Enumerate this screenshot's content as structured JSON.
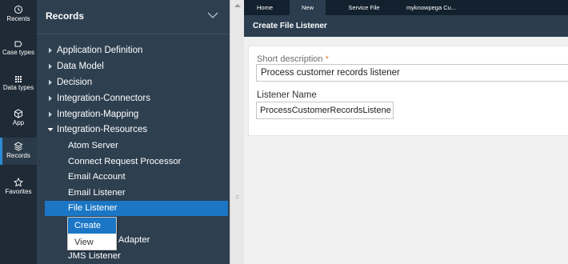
{
  "rail": {
    "items": [
      {
        "label": "Recents",
        "icon": "history-icon"
      },
      {
        "label": "Case types",
        "icon": "case-types-icon"
      },
      {
        "label": "Data types",
        "icon": "data-types-icon"
      },
      {
        "label": "App",
        "icon": "app-cube-icon"
      },
      {
        "label": "Records",
        "icon": "records-icon",
        "active": true
      },
      {
        "label": "Favorites",
        "icon": "star-icon"
      }
    ]
  },
  "records": {
    "title": "Records",
    "tree": [
      {
        "label": "Application Definition",
        "expanded": false
      },
      {
        "label": "Data Model",
        "expanded": false
      },
      {
        "label": "Decision",
        "expanded": false
      },
      {
        "label": "Integration-Connectors",
        "expanded": false
      },
      {
        "label": "Integration-Mapping",
        "expanded": false
      },
      {
        "label": "Integration-Resources",
        "expanded": true
      }
    ],
    "children": [
      "Atom Server",
      "Connect Request Processor",
      "Email Account",
      "Email Listener",
      "File Listener",
      "Generic Adapter",
      "JMS Listener"
    ],
    "partial_child_visible_text": "e Adapter",
    "selected_child": "File Listener"
  },
  "context_menu": {
    "items": [
      "Create",
      "View"
    ],
    "highlighted": "Create"
  },
  "tabs": [
    {
      "label": "Home",
      "active": false
    },
    {
      "label": "New",
      "active": true
    },
    {
      "label": "Service File",
      "active": false
    },
    {
      "label": "myknowpega Cu...",
      "active": false
    }
  ],
  "form": {
    "title": "Create File Listener",
    "short_description_label": "Short description",
    "short_description_value": "Process customer records listener",
    "listener_name_label": "Listener Name",
    "listener_name_value": "ProcessCustomerRecordsListene"
  },
  "colors": {
    "accent": "#1b77c5",
    "required": "#e8862b",
    "rail_bg": "#1e2a36",
    "panel_bg": "#2e3f50"
  }
}
